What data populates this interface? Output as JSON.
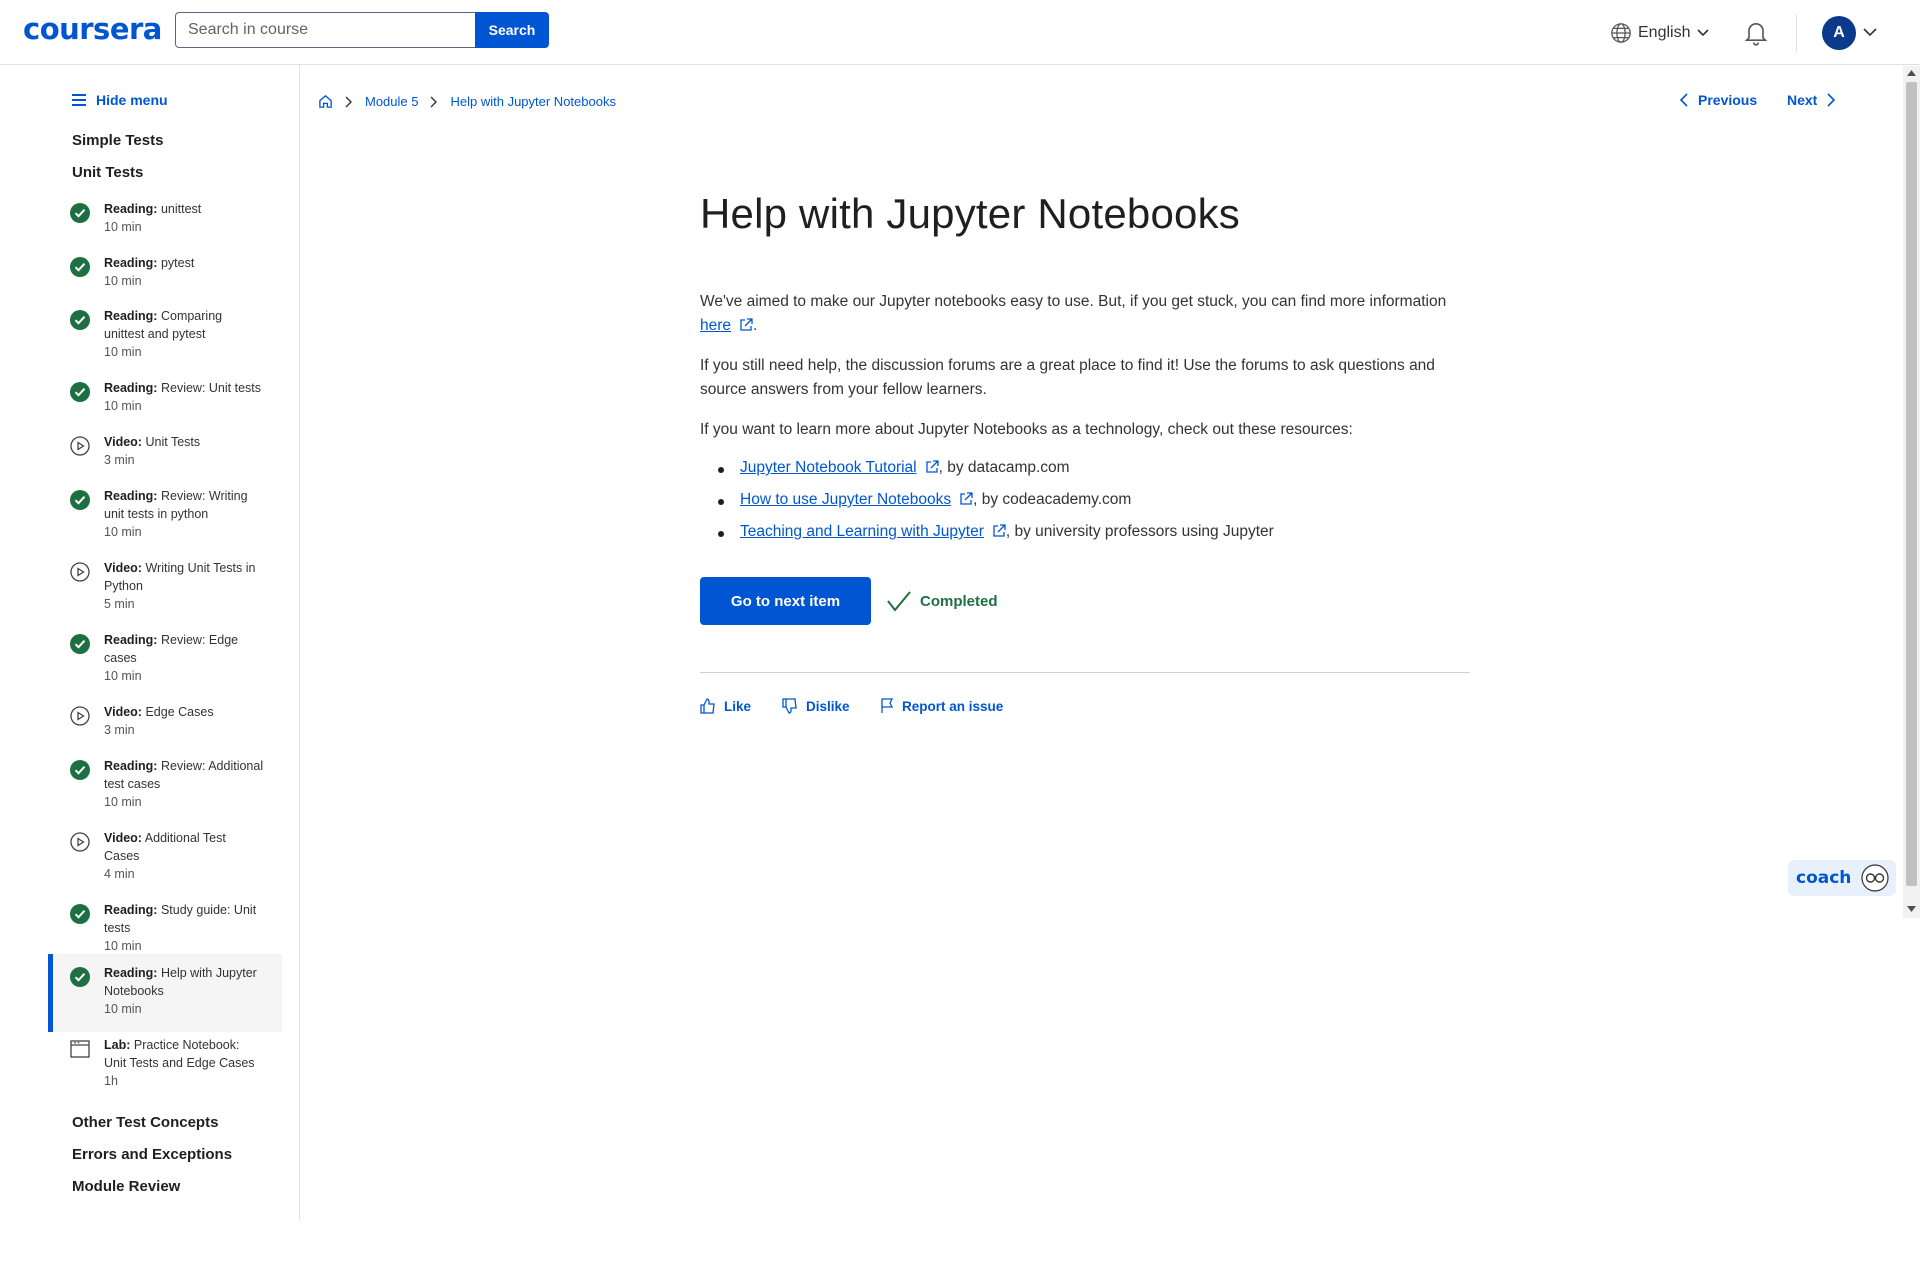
{
  "brand": {
    "name": "coursera",
    "color": "#0056d2"
  },
  "header": {
    "search_placeholder": "Search in course",
    "search_button": "Search",
    "language": "English",
    "avatar_initial": "A"
  },
  "sidebar": {
    "hide_menu": "Hide menu",
    "sections_top": [
      "Simple Tests",
      "Unit Tests"
    ],
    "items": [
      {
        "type": "Reading:",
        "title": "unittest",
        "duration": "10 min",
        "status": "completed"
      },
      {
        "type": "Reading:",
        "title": "pytest",
        "duration": "10 min",
        "status": "completed"
      },
      {
        "type": "Reading:",
        "title": "Comparing unittest and pytest",
        "duration": "10 min",
        "status": "completed"
      },
      {
        "type": "Reading:",
        "title": "Review: Unit tests",
        "duration": "10 min",
        "status": "completed"
      },
      {
        "type": "Video:",
        "title": "Unit Tests",
        "duration": "3 min",
        "status": "video"
      },
      {
        "type": "Reading:",
        "title": "Review: Writing unit tests in python",
        "duration": "10 min",
        "status": "completed"
      },
      {
        "type": "Video:",
        "title": "Writing Unit Tests in Python",
        "duration": "5 min",
        "status": "video"
      },
      {
        "type": "Reading:",
        "title": "Review: Edge cases",
        "duration": "10 min",
        "status": "completed"
      },
      {
        "type": "Video:",
        "title": "Edge Cases",
        "duration": "3 min",
        "status": "video"
      },
      {
        "type": "Reading:",
        "title": "Review: Additional test cases",
        "duration": "10 min",
        "status": "completed"
      },
      {
        "type": "Video:",
        "title": "Additional Test Cases",
        "duration": "4 min",
        "status": "video"
      },
      {
        "type": "Reading:",
        "title": "Study guide: Unit tests",
        "duration": "10 min",
        "status": "completed"
      },
      {
        "type": "Reading:",
        "title": "Help with Jupyter Notebooks",
        "duration": "10 min",
        "status": "completed-active"
      },
      {
        "type": "Lab:",
        "title": "Practice Notebook: Unit Tests and Edge Cases",
        "duration": "1h",
        "status": "lab"
      }
    ],
    "sections_bottom": [
      "Other Test Concepts",
      "Errors and Exceptions",
      "Module Review"
    ]
  },
  "breadcrumb": {
    "module": "Module 5",
    "page": "Help with Jupyter Notebooks"
  },
  "nav": {
    "previous": "Previous",
    "next": "Next"
  },
  "content": {
    "title": "Help with Jupyter Notebooks",
    "p1_text": "We've aimed to make our Jupyter notebooks easy to use. But, if you get stuck, you can find more information",
    "p1_link": "here",
    "p1_end": ".",
    "p2": "If you still need help, the discussion forums are a great place to find it! Use the forums to ask questions and source answers from your fellow learners.",
    "p3": "If you want to learn more about Jupyter Notebooks as a technology, check out these resources:",
    "resources": [
      {
        "link": "Jupyter Notebook Tutorial",
        "suffix": ", by datacamp.com"
      },
      {
        "link": "How to use Jupyter Notebooks",
        "suffix": ", by codeacademy.com"
      },
      {
        "link": "Teaching and Learning with Jupyter",
        "suffix": ", by university professors using Jupyter"
      }
    ],
    "next_button": "Go to next item",
    "completed": "Completed"
  },
  "feedback": {
    "like": "Like",
    "dislike": "Dislike",
    "report": "Report an issue"
  },
  "coach": {
    "label": "coach"
  },
  "colors": {
    "accent": "#0056d2",
    "success": "#1e7043",
    "active_bg": "#f5f5f5"
  }
}
